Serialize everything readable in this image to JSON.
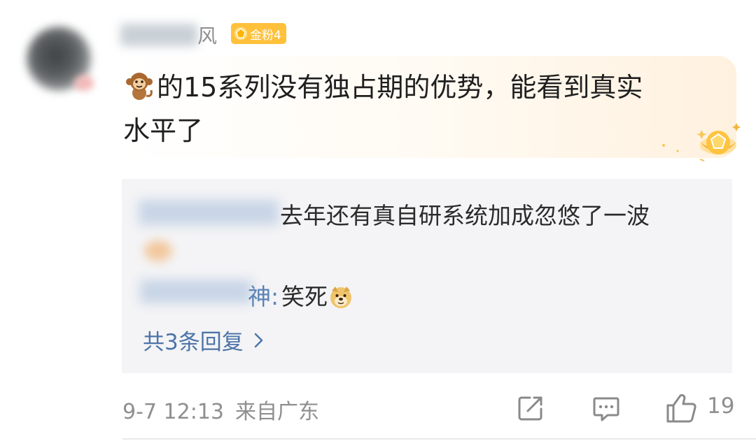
{
  "comment": {
    "username_visible": "风",
    "fan_badge": "金粉4",
    "text_line1": "的15系列没有独占期的优势，能看到真实",
    "text_line2": "水平了"
  },
  "replies": {
    "reply1_text": "去年还有真自研系统加成忽悠了一波",
    "reply2_name_tail": "神:",
    "reply2_text": "笑死",
    "more_label": "共3条回复"
  },
  "footer": {
    "time": "9-7 12:13",
    "location": "来自广东",
    "like_count": "19"
  },
  "icons": {
    "badge": "gem-icon",
    "emoji1": "monkey-emoji-icon",
    "emoji2": "doge-emoji-icon",
    "share": "share-icon",
    "reply": "comment-icon",
    "like": "thumbs-up-icon"
  },
  "colors": {
    "badge_bg": "#ffc13b",
    "link_blue": "#4d74a8",
    "meta_gray": "#8f8f8f"
  }
}
